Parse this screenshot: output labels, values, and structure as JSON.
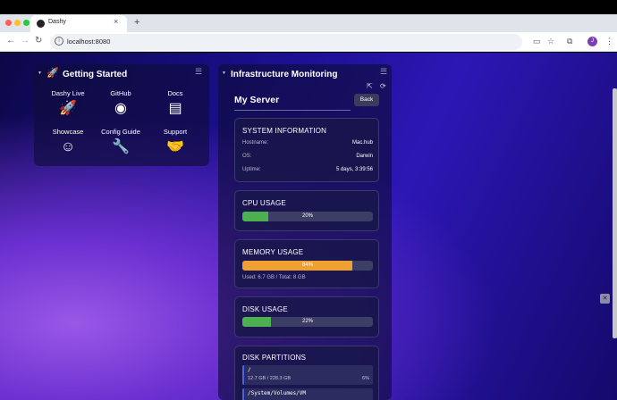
{
  "browser": {
    "tab_title": "Dashy",
    "tab_close": "×",
    "new_tab": "+",
    "url": "localhost:8080",
    "profile_initial": "J",
    "traffic_colors": [
      "#ff5f57",
      "#febc2e",
      "#28c840"
    ]
  },
  "getting_started": {
    "title": "Getting Started",
    "items": [
      {
        "label": "Dashy Live",
        "icon": "rocket-icon",
        "glyph": "🚀"
      },
      {
        "label": "GitHub",
        "icon": "github-icon",
        "glyph": "◉"
      },
      {
        "label": "Docs",
        "icon": "book-icon",
        "glyph": "▤"
      },
      {
        "label": "Showcase",
        "icon": "smiley-icon",
        "glyph": "☺"
      },
      {
        "label": "Config Guide",
        "icon": "wrench-icon",
        "glyph": "🔧"
      },
      {
        "label": "Support",
        "icon": "handshake-icon",
        "glyph": "🤝"
      }
    ]
  },
  "infrastructure": {
    "title": "Infrastructure Monitoring",
    "widget": {
      "server_name": "My Server",
      "back_label": "Back",
      "system_info": {
        "title": "SYSTEM INFORMATION",
        "rows": [
          {
            "label": "Hostname:",
            "value": "Mac.hub"
          },
          {
            "label": "OS:",
            "value": "Darwin"
          },
          {
            "label": "Uptime:",
            "value": "5 days, 3:39:56"
          }
        ]
      },
      "cpu": {
        "title": "CPU USAGE",
        "percent": 20,
        "percent_text": "20%",
        "color": "#4caf50"
      },
      "memory": {
        "title": "MEMORY USAGE",
        "percent": 84,
        "percent_text": "84%",
        "color": "#f0a030",
        "detail": "Used: 6.7 GB / Total: 8 GB"
      },
      "disk": {
        "title": "DISK USAGE",
        "percent": 22,
        "percent_text": "22%",
        "color": "#4caf50"
      },
      "partitions": {
        "title": "DISK PARTITIONS",
        "items": [
          {
            "name": "/",
            "size": "12.7 GB / 228.3 GB",
            "percent": "6%"
          },
          {
            "name": "/System/Volumes/VM",
            "size": "",
            "percent": ""
          }
        ]
      }
    }
  }
}
